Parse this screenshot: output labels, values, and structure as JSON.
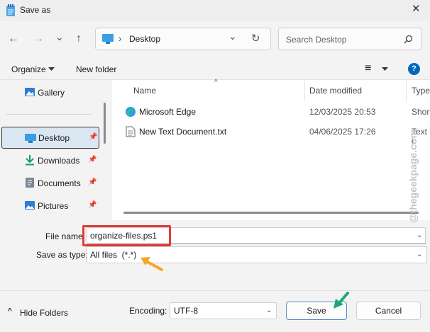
{
  "window": {
    "title": "Save as",
    "close_glyph": "✕"
  },
  "nav": {
    "back_icon": "←",
    "forward_icon": "→",
    "recent_icon": "⌄",
    "up_icon": "↑",
    "breadcrumb_sep": "›",
    "location": "Desktop",
    "dropdown_icon": "⌄",
    "refresh_icon": "↻"
  },
  "search": {
    "placeholder": "Search Desktop"
  },
  "commandbar": {
    "organize": "Organize",
    "new_folder": "New folder",
    "view_icon": "≡",
    "help": "?"
  },
  "sidebar": {
    "items": [
      {
        "label": "Gallery",
        "pinned": false
      },
      {
        "label": "Desktop",
        "pinned": true,
        "selected": true
      },
      {
        "label": "Downloads",
        "pinned": true
      },
      {
        "label": "Documents",
        "pinned": true
      },
      {
        "label": "Pictures",
        "pinned": true
      }
    ],
    "pin_glyph": "📌"
  },
  "filelist": {
    "columns": [
      "Name",
      "Date modified",
      "Type"
    ],
    "sort_indicator": "^",
    "rows": [
      {
        "name": "Microsoft Edge",
        "date": "12/03/2025 20:53",
        "type": "Short"
      },
      {
        "name": "New Text Document.txt",
        "date": "04/06/2025 17:26",
        "type": "Text I"
      }
    ]
  },
  "form": {
    "filename_label": "File name:",
    "filename_value": "organize-files.ps1",
    "savetype_label": "Save as type:",
    "savetype_value": "All files  (*.*)",
    "hide_folders": "Hide Folders",
    "hide_icon": "^",
    "encoding_label": "Encoding:",
    "encoding_value": "UTF-8",
    "save": "Save",
    "cancel": "Cancel"
  },
  "watermark": "@thegeekpage.com",
  "colors": {
    "highlight": "#e53935",
    "arrow_orange": "#f5a623",
    "arrow_green": "#1aaa7a",
    "accent": "#0067c0"
  }
}
